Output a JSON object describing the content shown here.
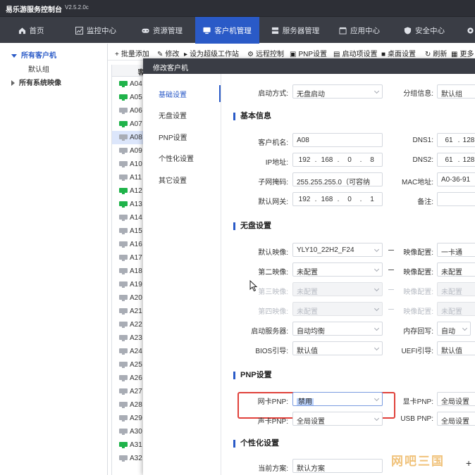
{
  "app": {
    "title": "易乐游服务控制台",
    "version": "V2.5.2.0c"
  },
  "nav": {
    "tabs": [
      {
        "label": "首页",
        "icon": "home-icon"
      },
      {
        "label": "监控中心",
        "icon": "chart-icon"
      },
      {
        "label": "资源管理",
        "icon": "gamepad-icon"
      },
      {
        "label": "客户机管理",
        "icon": "monitor-icon"
      },
      {
        "label": "服务器管理",
        "icon": "server-icon"
      },
      {
        "label": "应用中心",
        "icon": "box-icon"
      },
      {
        "label": "安全中心",
        "icon": "shield-icon"
      }
    ],
    "active": "客户机管理"
  },
  "sidebar": {
    "items": [
      {
        "label": "所有客户机"
      },
      {
        "label": "默认组"
      },
      {
        "label": "所有系统映像"
      }
    ]
  },
  "toolbar": {
    "buttons": [
      "批量添加",
      "修改",
      "设为超级工作站",
      "远程控制",
      "PNP设置",
      "启动项设置",
      "桌面设置",
      "刷新",
      "更多"
    ]
  },
  "client_list": {
    "header": "客",
    "rows": [
      {
        "name": "A04",
        "online": true
      },
      {
        "name": "A05",
        "online": true
      },
      {
        "name": "A06",
        "online": false
      },
      {
        "name": "A07",
        "online": true
      },
      {
        "name": "A08",
        "online": false
      },
      {
        "name": "A09",
        "online": false
      },
      {
        "name": "A10",
        "online": false
      },
      {
        "name": "A11",
        "online": false
      },
      {
        "name": "A12",
        "online": true
      },
      {
        "name": "A13",
        "online": true
      },
      {
        "name": "A14",
        "online": false
      },
      {
        "name": "A15",
        "online": false
      },
      {
        "name": "A16",
        "online": false
      },
      {
        "name": "A17",
        "online": false
      },
      {
        "name": "A18",
        "online": false
      },
      {
        "name": "A19",
        "online": false
      },
      {
        "name": "A20",
        "online": false
      },
      {
        "name": "A21",
        "online": false
      },
      {
        "name": "A22",
        "online": false
      },
      {
        "name": "A23",
        "online": false
      },
      {
        "name": "A24",
        "online": false
      },
      {
        "name": "A25",
        "online": false
      },
      {
        "name": "A26",
        "online": false
      },
      {
        "name": "A27",
        "online": false
      },
      {
        "name": "A28",
        "online": false
      },
      {
        "name": "A29",
        "online": false
      },
      {
        "name": "A30",
        "online": false
      },
      {
        "name": "A31",
        "online": true
      },
      {
        "name": "A32",
        "online": false
      }
    ],
    "selected": "A08"
  },
  "dialog": {
    "title": "修改客户机",
    "nav": [
      "基础设置",
      "无盘设置",
      "PNP设置",
      "个性化设置",
      "其它设置"
    ],
    "top": {
      "boot_mode_label": "启动方式:",
      "boot_mode_value": "无盘启动",
      "group_label": "分组信息:",
      "group_value": "默认组"
    },
    "basic": {
      "title": "基本信息",
      "name_label": "客户机名:",
      "name_value": "A08",
      "dns1_label": "DNS1:",
      "dns1": [
        "61",
        "128"
      ],
      "ip_label": "IP地址:",
      "ip": [
        "192",
        "168",
        "0",
        "8"
      ],
      "dns2_label": "DNS2:",
      "dns2": [
        "61",
        "128"
      ],
      "mask_label": "子网掩码:",
      "mask_value": "255.255.255.0（可容纳",
      "mac_label": "MAC地址:",
      "mac_value": "A0-36-91",
      "gw_label": "默认网关:",
      "gw": [
        "192",
        "168",
        "0",
        "1"
      ],
      "note_label": "备注:",
      "note_value": ""
    },
    "diskless": {
      "title": "无盘设置",
      "img1_label": "默认映像:",
      "img1_value": "YLY10_22H2_F24",
      "img2_label": "第二映像:",
      "img2_value": "未配置",
      "img3_label": "第三映像:",
      "img3_value": "未配置",
      "img4_label": "第四映像:",
      "img4_value": "未配置",
      "cfg_label": "映像配置:",
      "cfg1_value": "一卡通",
      "cfg2_value": "未配置",
      "cfg3_value": "未配置",
      "cfg4_value": "未配置",
      "server_label": "启动服务器:",
      "server_value": "自动均衡",
      "mem_label": "内存回写:",
      "mem_value": "自动",
      "bios_label": "BIOS引导:",
      "bios_value": "默认值",
      "uefi_label": "UEFI引导:",
      "uefi_value": "默认值"
    },
    "pnp": {
      "title": "PNP设置",
      "nic_label": "网卡PNP:",
      "nic_value": "禁用",
      "gpu_label": "显卡PNP:",
      "gpu_value": "全局设置",
      "snd_label": "声卡PNP:",
      "snd_value": "全局设置",
      "usb_label": "USB PNP:",
      "usb_value": "全局设置"
    },
    "personal": {
      "title": "个性化设置",
      "scheme_label": "当前方案:",
      "scheme_value": "默认方案"
    }
  },
  "watermark": "网吧三国",
  "colors": {
    "accent": "#2a5ac7",
    "nav_bg": "#3a3d45",
    "title_bg": "#2d2f36",
    "online": "#1fb34a",
    "offline": "#a9adb5",
    "highlight": "#e0413a"
  }
}
